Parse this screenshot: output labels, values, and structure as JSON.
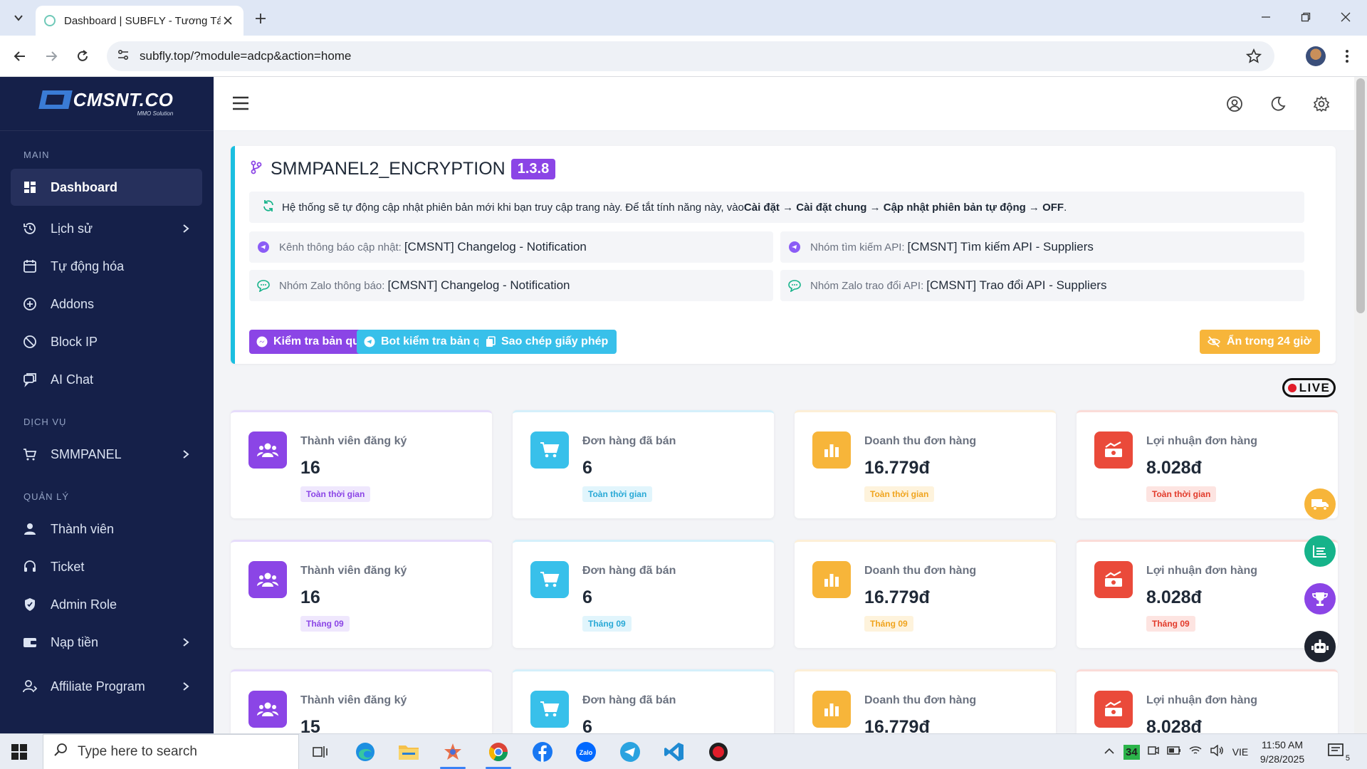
{
  "browser": {
    "tab_title": "Dashboard | SUBFLY - Tương Tá",
    "url": "subfly.top/?module=adcp&action=home"
  },
  "sidebar": {
    "logo_text": "CMSNT.CO",
    "logo_sub": "MMO Solution",
    "sections": {
      "main": "MAIN",
      "services": "DỊCH VỤ",
      "manage": "QUẢN LÝ"
    },
    "items": {
      "dashboard": "Dashboard",
      "history": "Lịch sử",
      "automation": "Tự động hóa",
      "addons": "Addons",
      "block_ip": "Block IP",
      "ai_chat": "AI Chat",
      "smmpanel": "SMMPANEL",
      "members": "Thành viên",
      "ticket": "Ticket",
      "admin_role": "Admin Role",
      "deposit": "Nạp tiền",
      "affiliate": "Affiliate Program"
    }
  },
  "update_card": {
    "title": "SMMPANEL2_ENCRYPTION",
    "version": "1.3.8",
    "notice_prefix": "Hệ thống sẽ tự động cập nhật phiên bản mới khi bạn truy cập trang này. Để tắt tính năng này, vào ",
    "notice_path": "Cài đặt → Cài đặt chung → Cập nhật phiên bản tự động → OFF",
    "notice_suffix": ".",
    "links": [
      {
        "label": "Kênh thông báo cập nhật:",
        "value": "[CMSNT] Changelog - Notification"
      },
      {
        "label": "Nhóm tìm kiếm API:",
        "value": "[CMSNT] Tìm kiếm API - Suppliers"
      },
      {
        "label": "Nhóm Zalo thông báo:",
        "value": "[CMSNT] Changelog - Notification"
      },
      {
        "label": "Nhóm Zalo trao đổi API:",
        "value": "[CMSNT] Trao đổi API - Suppliers"
      }
    ],
    "buttons": {
      "check_license": "Kiểm tra bản quyền",
      "bot_check": "Bot kiểm tra bản quyền",
      "copy_license": "Sao chép giấy phép",
      "hide_24h": "Ẩn trong 24 giờ"
    },
    "colors": {
      "accent": "#1bbfe0",
      "purple": "#8b45e6",
      "cyan": "#38c0ea",
      "orange": "#f7b53a"
    }
  },
  "live_label": "LIVE",
  "stats": [
    {
      "label": "Thành viên đăng ký",
      "value": "16",
      "badge": "Toàn thời gian",
      "color": "#8b45e6"
    },
    {
      "label": "Đơn hàng đã bán",
      "value": "6",
      "badge": "Toàn thời gian",
      "color": "#38c0ea"
    },
    {
      "label": "Doanh thu đơn hàng",
      "value": "16.779đ",
      "badge": "Toàn thời gian",
      "color": "#f7b53a"
    },
    {
      "label": "Lợi nhuận đơn hàng",
      "value": "8.028đ",
      "badge": "Toàn thời gian",
      "color": "#ea4a3a"
    },
    {
      "label": "Thành viên đăng ký",
      "value": "16",
      "badge": "Tháng 09",
      "color": "#8b45e6"
    },
    {
      "label": "Đơn hàng đã bán",
      "value": "6",
      "badge": "Tháng 09",
      "color": "#38c0ea"
    },
    {
      "label": "Doanh thu đơn hàng",
      "value": "16.779đ",
      "badge": "Tháng 09",
      "color": "#f7b53a"
    },
    {
      "label": "Lợi nhuận đơn hàng",
      "value": "8.028đ",
      "badge": "Tháng 09",
      "color": "#ea4a3a"
    },
    {
      "label": "Thành viên đăng ký",
      "value": "15",
      "badge": "",
      "color": "#8b45e6"
    },
    {
      "label": "Đơn hàng đã bán",
      "value": "6",
      "badge": "",
      "color": "#38c0ea"
    },
    {
      "label": "Doanh thu đơn hàng",
      "value": "16.779đ",
      "badge": "",
      "color": "#f7b53a"
    },
    {
      "label": "Lợi nhuận đơn hàng",
      "value": "8.028đ",
      "badge": "",
      "color": "#ea4a3a"
    }
  ],
  "taskbar": {
    "search_placeholder": "Type here to search",
    "weather_temp": "34",
    "language": "VIE",
    "time": "11:50 AM",
    "date": "9/28/2025",
    "notification_count": "5"
  }
}
